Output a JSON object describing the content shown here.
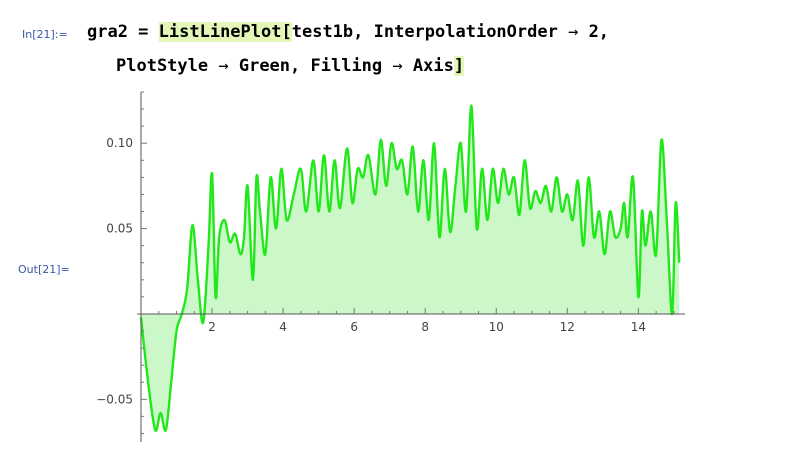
{
  "input": {
    "label": "In[21]:=",
    "line1": {
      "assign": "gra2 = ",
      "func": "ListLinePlot",
      "bracket_open": "[",
      "args": "test1b, InterpolationOrder",
      "arrow": " → ",
      "value": "2,"
    },
    "line2": {
      "opt1": "PlotStyle",
      "arrow1": " → ",
      "val1": "Green, ",
      "opt2": "Filling",
      "arrow2": " → ",
      "val2": "Axis",
      "bracket_close": "]"
    }
  },
  "output": {
    "label": "Out[21]="
  },
  "colors": {
    "line": "#22e81b",
    "fill": "#ccf7c8",
    "highlight": "#e4f7b8",
    "label": "#3b58a8"
  },
  "chart_data": {
    "type": "area",
    "xlim": [
      0,
      15.2
    ],
    "ylim": [
      -0.075,
      0.13
    ],
    "x_ticks": [
      2,
      4,
      6,
      8,
      10,
      12,
      14
    ],
    "y_ticks": [
      0.1,
      0.05,
      -0.05
    ],
    "y_tick_labels": [
      "0.10",
      "0.05",
      "−0.05"
    ],
    "grid": false,
    "fill_to": "axis",
    "series": [
      {
        "x": [
          0,
          0.2,
          0.4,
          0.55,
          0.7,
          0.85,
          1.0,
          1.15,
          1.3,
          1.45,
          1.6,
          1.75,
          1.9,
          2.0,
          2.1,
          2.2,
          2.35,
          2.5,
          2.65,
          2.8,
          2.9,
          3.0,
          3.15,
          3.25,
          3.35,
          3.5,
          3.65,
          3.8,
          3.95,
          4.1,
          4.3,
          4.5,
          4.65,
          4.85,
          5.0,
          5.15,
          5.3,
          5.45,
          5.6,
          5.8,
          5.95,
          6.1,
          6.25,
          6.4,
          6.6,
          6.75,
          6.9,
          7.05,
          7.2,
          7.35,
          7.5,
          7.65,
          7.8,
          7.95,
          8.1,
          8.25,
          8.4,
          8.55,
          8.7,
          8.85,
          9.0,
          9.15,
          9.3,
          9.45,
          9.6,
          9.75,
          9.9,
          10.05,
          10.2,
          10.35,
          10.5,
          10.65,
          10.8,
          10.95,
          11.1,
          11.25,
          11.4,
          11.55,
          11.7,
          11.85,
          12.0,
          12.15,
          12.3,
          12.45,
          12.6,
          12.75,
          12.9,
          13.05,
          13.2,
          13.35,
          13.5,
          13.6,
          13.7,
          13.85,
          14.0,
          14.1,
          14.2,
          14.35,
          14.5,
          14.65,
          14.8,
          14.95,
          15.05,
          15.15
        ],
        "y": [
          -0.002,
          -0.04,
          -0.068,
          -0.058,
          -0.068,
          -0.04,
          -0.01,
          0.0,
          0.015,
          0.052,
          0.02,
          -0.005,
          0.04,
          0.082,
          0.01,
          0.045,
          0.055,
          0.042,
          0.047,
          0.035,
          0.045,
          0.075,
          0.02,
          0.08,
          0.06,
          0.035,
          0.08,
          0.05,
          0.085,
          0.055,
          0.07,
          0.085,
          0.06,
          0.09,
          0.06,
          0.093,
          0.06,
          0.09,
          0.062,
          0.097,
          0.065,
          0.085,
          0.08,
          0.093,
          0.07,
          0.102,
          0.075,
          0.1,
          0.085,
          0.09,
          0.07,
          0.098,
          0.06,
          0.09,
          0.055,
          0.1,
          0.045,
          0.085,
          0.048,
          0.075,
          0.1,
          0.06,
          0.122,
          0.05,
          0.085,
          0.055,
          0.085,
          0.065,
          0.085,
          0.07,
          0.08,
          0.058,
          0.09,
          0.062,
          0.072,
          0.065,
          0.075,
          0.06,
          0.08,
          0.06,
          0.07,
          0.055,
          0.078,
          0.04,
          0.08,
          0.045,
          0.06,
          0.035,
          0.06,
          0.045,
          0.05,
          0.065,
          0.045,
          0.08,
          0.01,
          0.06,
          0.04,
          0.06,
          0.035,
          0.102,
          0.055,
          0.0,
          0.065,
          0.03
        ]
      }
    ]
  }
}
